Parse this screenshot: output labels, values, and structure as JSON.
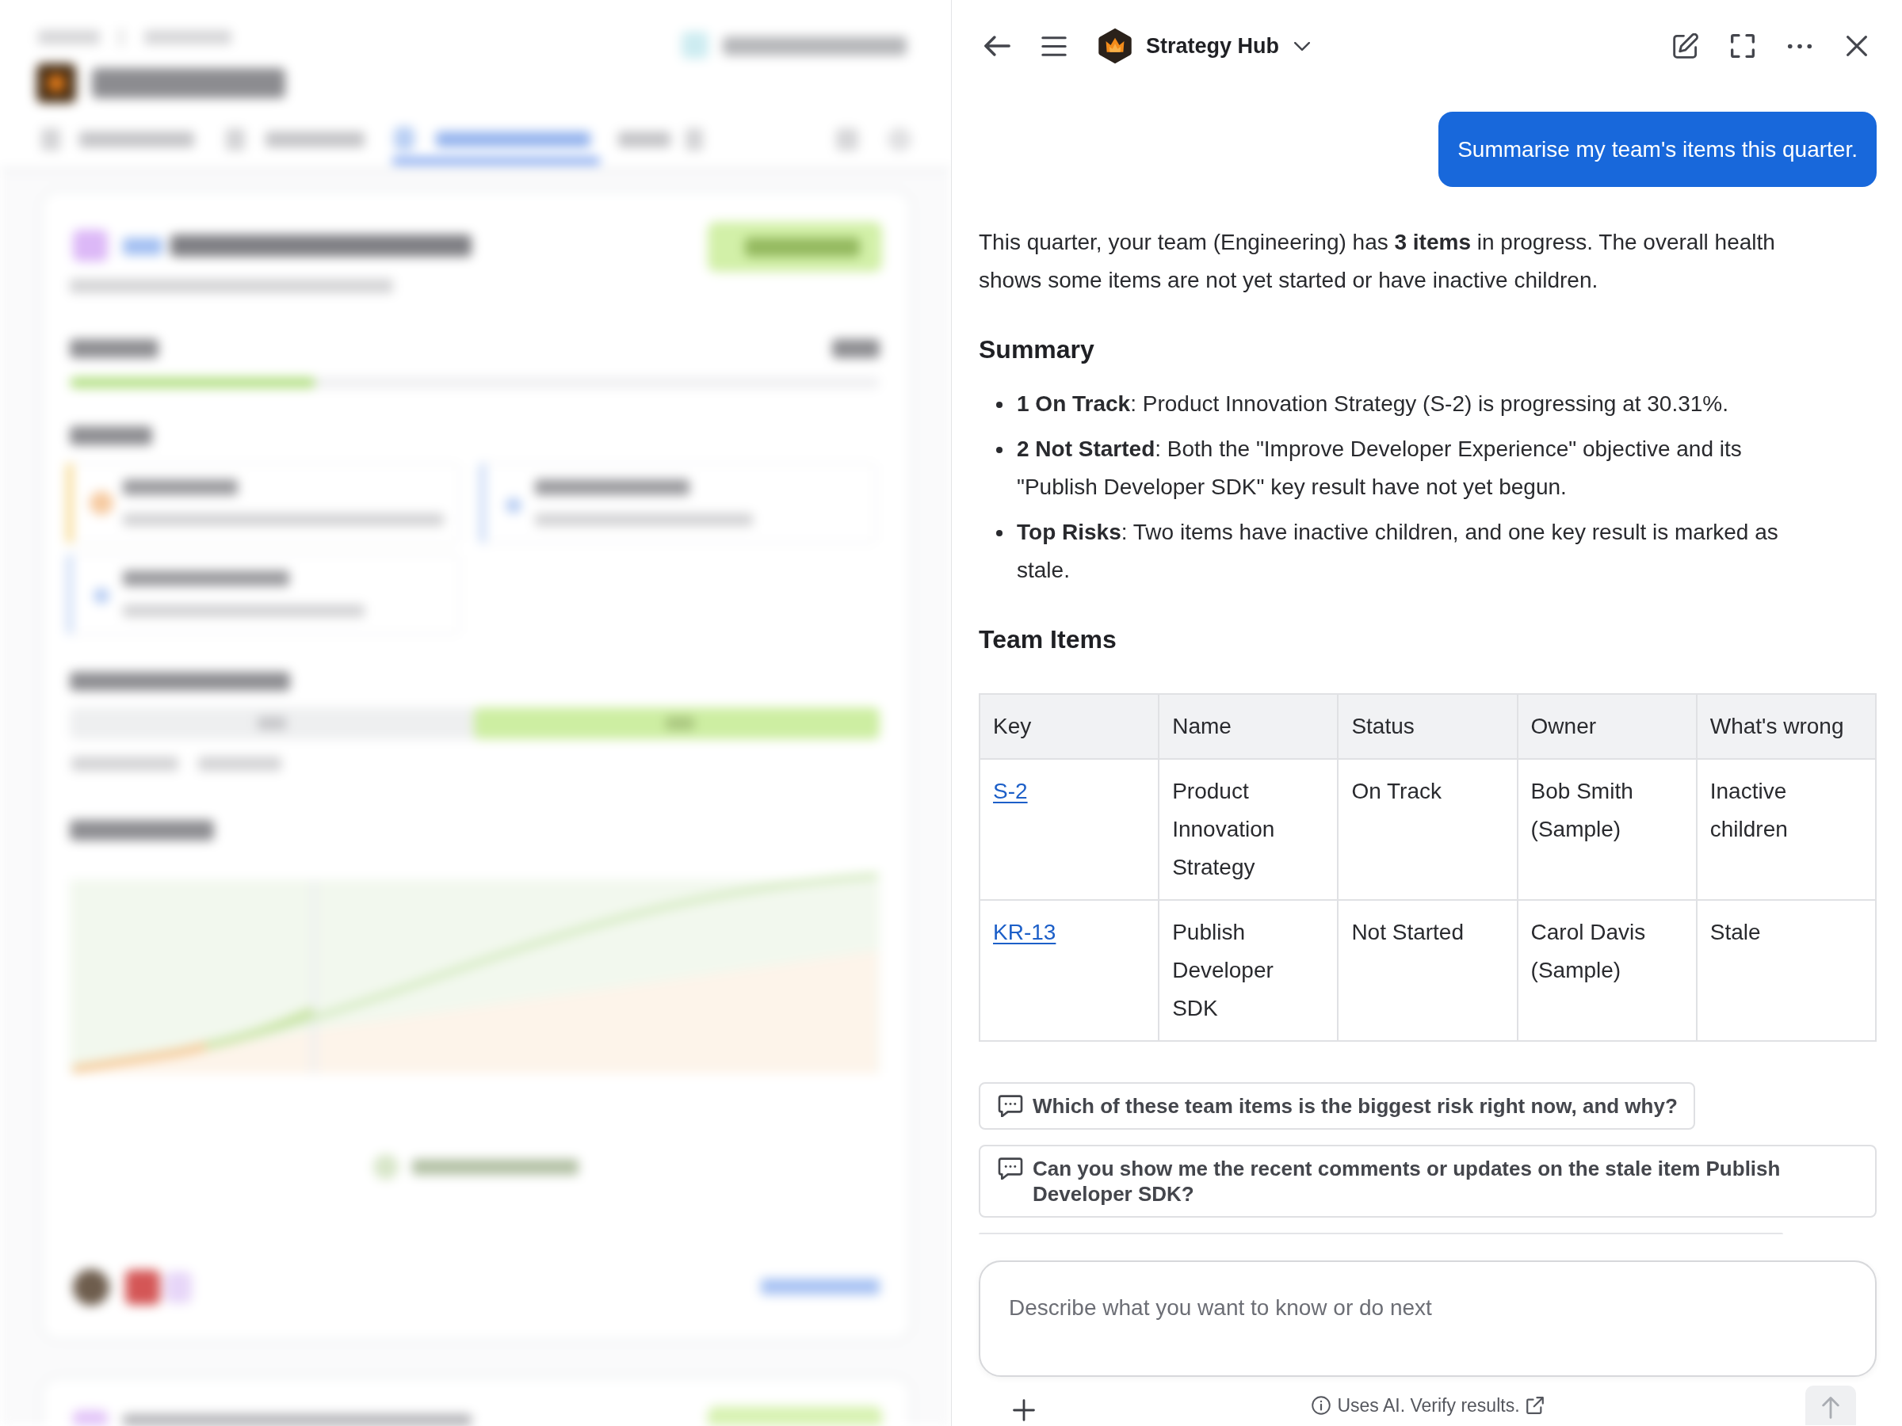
{
  "panel": {
    "title": "Strategy Hub"
  },
  "user_message": {
    "text": "Summarise my team's items this quarter."
  },
  "reply": {
    "intro": "This quarter, your team (Engineering) has **3 items** in progress. The overall health shows some items are not yet started or have inactive children.",
    "summary": {
      "heading": "Summary",
      "bullets": [
        "**1 On Track**: Product Innovation Strategy (S-2) is progressing at 30.31%.",
        "**2 Not Started**: Both the \"Improve Developer Experience\" objective and its \"Publish Developer SDK\" key result have not yet begun.",
        "**Top Risks**: Two items have inactive children, and one key result is marked as stale."
      ]
    },
    "team_items": {
      "heading": "Team Items",
      "table": {
        "columns": [
          "Key",
          "Name",
          "Status",
          "Owner",
          "What's wrong"
        ],
        "rows": [
          [
            "S-2",
            "Product Innovation Strategy",
            "On Track",
            "Bob Smith (Sample)",
            "Inactive children"
          ],
          [
            "KR-13",
            "Publish Developer SDK",
            "Not Started",
            "Carol Davis (Sample)",
            "Stale"
          ]
        ]
      }
    }
  },
  "suggestions": [
    "Which of these team items is the biggest risk right now, and why?",
    "Can you show me the recent comments or updates on the stale item Publish Developer SDK?"
  ],
  "composer": {
    "placeholder": "Describe what you want to know or do next",
    "notice": "Uses AI. Verify results.",
    "send_button": {
      "disabled": true
    }
  }
}
